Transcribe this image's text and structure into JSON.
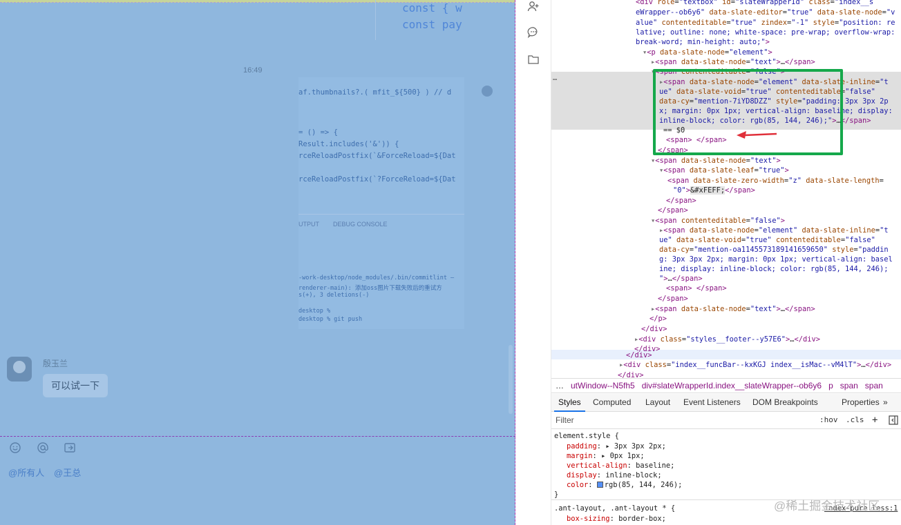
{
  "chat": {
    "code_lines": [
      "const { w",
      "const pay"
    ],
    "timestamp": "16:49",
    "shot_lines": [
      "af.thumbnails?.( mfit_${500} ) // d",
      "= () => {",
      "Result.includes('&')) {",
      "rceReloadPostfix(`&ForceReload=${Dat",
      "rceReloadPostfix(`?ForceReload=${Dat"
    ],
    "shot_tabs": [
      "UTPUT",
      "DEBUG CONSOLE"
    ],
    "shot_terminal": [
      "-work-desktop/node_modules/.bin/commitlint —",
      "renderer-main): 添加oss图片下载失败后的重试方",
      "s(+), 3 deletions(-)",
      "desktop %",
      "desktop % git push"
    ],
    "sender_name": "殷玉兰",
    "message": "可以试一下",
    "mentions": [
      "@所有人",
      "@王总"
    ]
  },
  "devtools": {
    "crumbs": [
      "…",
      "utWindow--N5fh5",
      "div#slateWrapperId.index__slateWrapper--ob6y6",
      "p",
      "span",
      "span"
    ],
    "tabs": [
      "Styles",
      "Computed",
      "Layout",
      "Event Listeners",
      "DOM Breakpoints",
      "Properties",
      "»"
    ],
    "filter_placeholder": "Filter",
    "filter_buttons": [
      ":hov",
      ".cls",
      "+"
    ],
    "rule1_selector": "element.style {",
    "rule1_props": [
      {
        "name": "padding",
        "value": "▸ 3px 3px 2px;"
      },
      {
        "name": "margin",
        "value": "▸ 0px 1px;"
      },
      {
        "name": "vertical-align",
        "value": "baseline;"
      },
      {
        "name": "display",
        "value": "inline-block;"
      },
      {
        "name": "color",
        "value": "rgb(85, 144, 246);"
      }
    ],
    "rule1_close": "}",
    "rule2_selector": ".ant-layout, .ant-layout * {",
    "rule2_prop": {
      "name": "box-sizing",
      "value": "border-box;"
    },
    "rule2_file": "index-pure.less:1",
    "watermark": "@稀土掘金技术社区",
    "dom_dollar": "== $0",
    "dom_ellipsis": "…"
  },
  "colors": {
    "highlight_green": "#15a84b",
    "arrow_red": "#e0303a",
    "mention_color": "rgb(85, 144, 246)"
  }
}
